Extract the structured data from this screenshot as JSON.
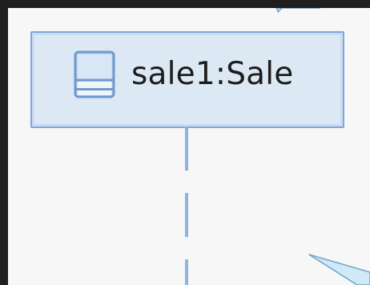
{
  "diagram": {
    "lifeline": {
      "label": "sale1:Sale",
      "icon": "class-icon"
    }
  },
  "colors": {
    "border": "#7fa7d9",
    "fill": "#dde8f5",
    "dash": "#8fb3df",
    "callout": "#cfe9f7"
  }
}
